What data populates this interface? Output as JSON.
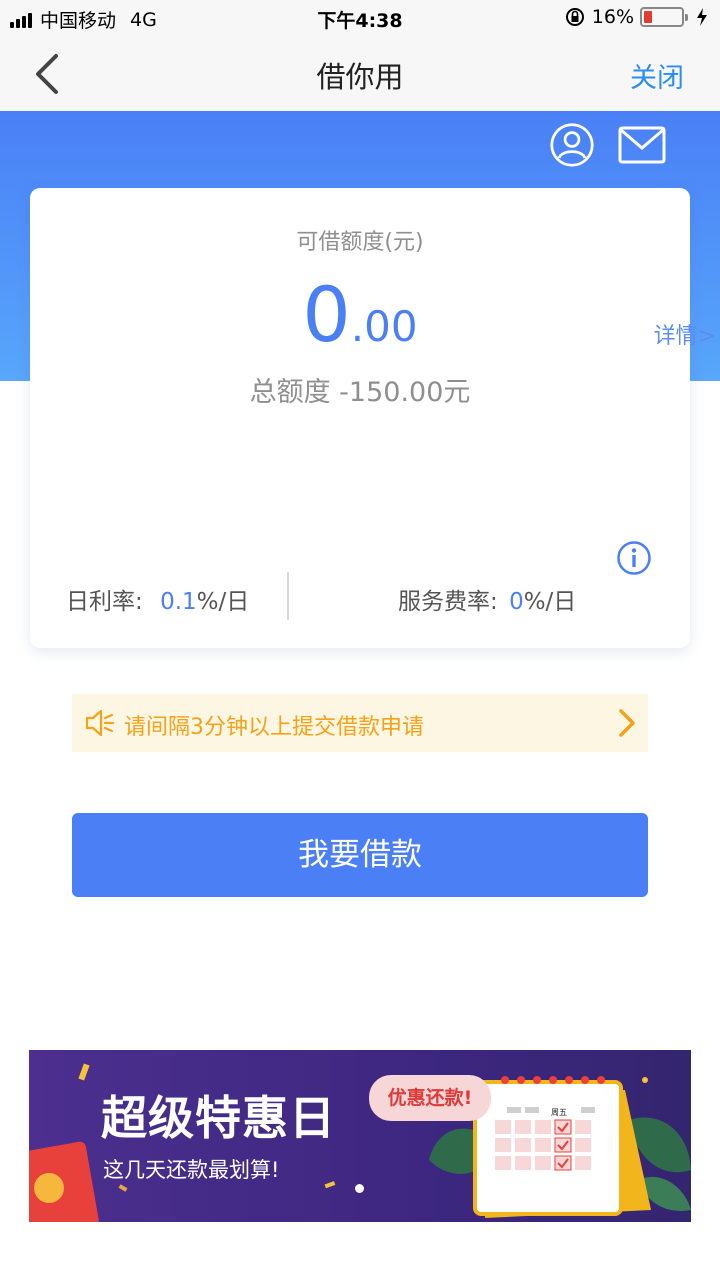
{
  "status_bar": {
    "carrier": "中国移动",
    "network": "4G",
    "time": "下午4:38",
    "battery_percent": "16%",
    "battery_level": 0.16,
    "battery_color": "#e53935"
  },
  "nav": {
    "back_icon": "chevron-left-icon",
    "title": "借你用",
    "close_label": "关闭"
  },
  "header": {
    "user_icon": "user-circle-icon",
    "mail_icon": "mail-icon",
    "detail_link": "详情>"
  },
  "card": {
    "label": "可借额度(元)",
    "amount_int": "0",
    "amount_dec": ".00",
    "total_line": "总额度 -150.00元",
    "info_icon": "info-icon",
    "daily_rate_label": "日利率:",
    "daily_rate_value": "0.1",
    "daily_rate_unit": "%/日",
    "service_rate_label": "服务费率:",
    "service_rate_value": "0",
    "service_rate_unit": "%/日"
  },
  "notice": {
    "icon": "speaker-icon",
    "text": "请间隔3分钟以上提交借款申请",
    "arrow_icon": "chevron-right-icon"
  },
  "borrow_button": {
    "label": "我要借款"
  },
  "banner": {
    "title": "超级特惠日",
    "subtitle": "这几天还款最划算!",
    "bubble": "优惠还款!",
    "calendar_header": "周五",
    "page_indicator_count": 1
  },
  "colors": {
    "accent": "#4a7ff5",
    "nav_link": "#2d8cf0",
    "notice_text": "#f3a21a",
    "notice_bg": "#fdf6e3",
    "header_gradient_top": "#4a80f6",
    "header_gradient_bottom": "#58a6fb"
  }
}
